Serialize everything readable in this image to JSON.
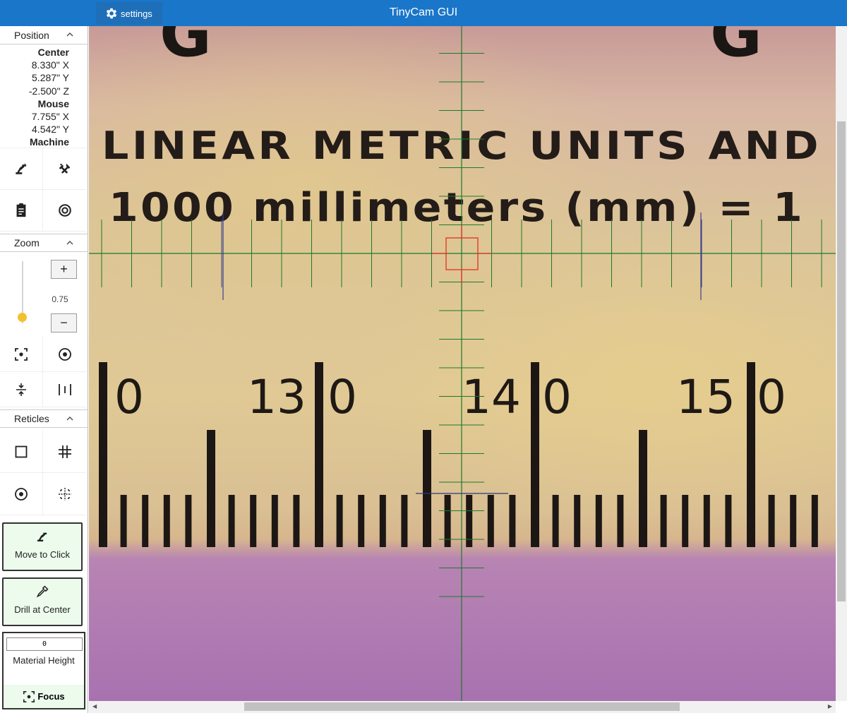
{
  "titlebar": {
    "settings_label": "settings",
    "title": "TinyCam GUI",
    "color": "#1976c9"
  },
  "sidebar": {
    "position": {
      "header": "Position",
      "center_label": "Center",
      "center_x": "8.330\" X",
      "center_y": "5.287\" Y",
      "center_z": "-2.500\" Z",
      "mouse_label": "Mouse",
      "mouse_x": "7.755\" X",
      "mouse_y": "4.542\" Y",
      "machine_label": "Machine",
      "tools": [
        "cnc-machine-icon",
        "tools-icon",
        "clipboard-icon",
        "target-at-icon"
      ]
    },
    "zoom": {
      "header": "Zoom",
      "plus_label": "+",
      "minus_label": "−",
      "value": "0.75",
      "slider_level": 0.1,
      "tools": [
        "focus-center-icon",
        "circle-dot-icon",
        "compress-vertical-icon",
        "expand-horizontal-icon"
      ]
    },
    "reticles": {
      "header": "Reticles",
      "tools": [
        "square-reticle-icon",
        "grid-reticle-icon",
        "circle-reticle-icon",
        "dashed-grid-reticle-icon"
      ]
    },
    "move_to_click_label": "Move to Click",
    "drill_at_center_label": "Drill at Center",
    "material": {
      "value": "0",
      "label": "Material Height",
      "focus_label": "Focus"
    },
    "accent_green": "#ecfbec",
    "slider_color": "#f2c12e"
  },
  "camera": {
    "text_line1": "LINEAR METRIC UNITS AND",
    "text_line2": "1000 millimeters (mm) = 1",
    "ruler_numbers": [
      "0",
      "13",
      "0",
      "14",
      "0",
      "15",
      "0"
    ],
    "crosshair_color": "#1d7a2c",
    "reticle_color": "#e53024"
  }
}
